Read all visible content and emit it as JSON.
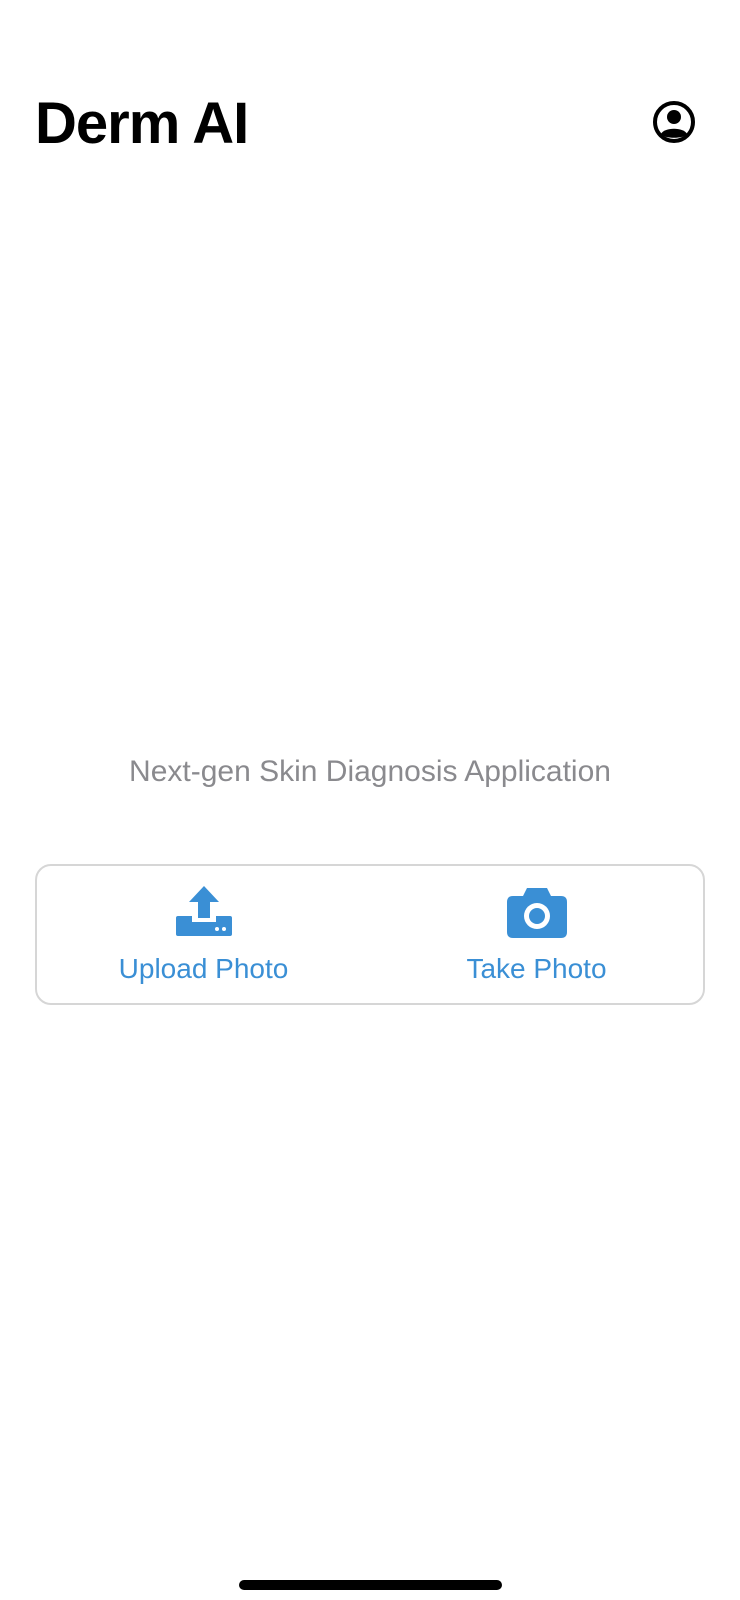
{
  "header": {
    "title": "Derm AI",
    "profile_icon": "user-circle-icon"
  },
  "main": {
    "tagline": "Next-gen Skin Diagnosis Application",
    "actions": [
      {
        "label": "Upload Photo",
        "icon": "upload-icon"
      },
      {
        "label": "Take Photo",
        "icon": "camera-icon"
      }
    ]
  },
  "colors": {
    "accent": "#3a8fd5",
    "tagline": "#8a8a8e",
    "card_border": "#d6d6d6",
    "title": "#000000"
  }
}
